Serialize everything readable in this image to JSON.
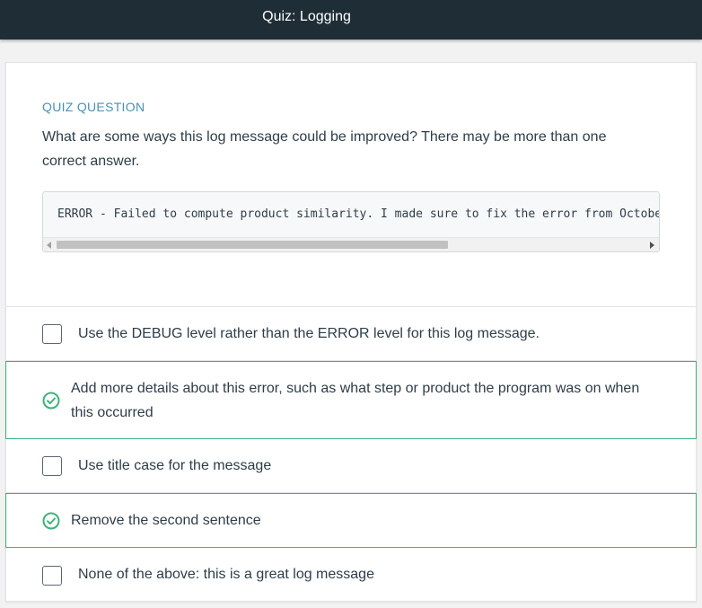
{
  "header": {
    "title": "Quiz: Logging"
  },
  "quiz": {
    "label": "QUIZ QUESTION",
    "question": "What are some ways this log message could be improved? There may be more than one correct answer.",
    "code": "ERROR - Failed to compute product similarity. I made sure to fix the error from October"
  },
  "options": [
    {
      "label": "Use the DEBUG level rather than the ERROR level for this log message.",
      "correct": false
    },
    {
      "label": "Add more details about this error, such as what step or product the program was on when this occurred",
      "correct": true
    },
    {
      "label": "Use title case for the message",
      "correct": false
    },
    {
      "label": "Remove the second sentence",
      "correct": true
    },
    {
      "label": "None of the above: this is a great log message",
      "correct": false
    }
  ],
  "colors": {
    "header_bg": "#1f2d36",
    "accent_label": "#4a90b8",
    "correct_green": "#3cb37a"
  },
  "icons": {
    "correct": "check-circle-icon",
    "unchecked": "checkbox-icon"
  }
}
